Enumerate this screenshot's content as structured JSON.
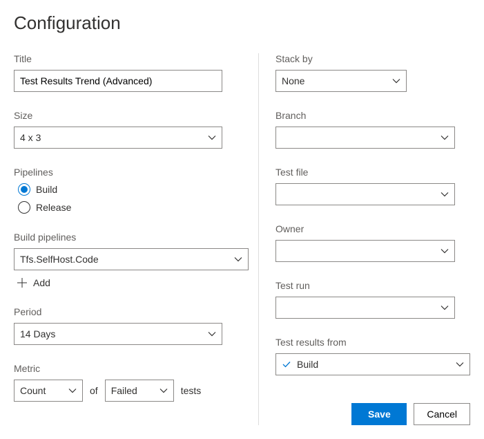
{
  "heading": "Configuration",
  "left": {
    "title_label": "Title",
    "title_value": "Test Results Trend (Advanced)",
    "size_label": "Size",
    "size_value": "4 x 3",
    "pipelines_label": "Pipelines",
    "pipelines_options": {
      "build": "Build",
      "release": "Release"
    },
    "build_pipelines_label": "Build pipelines",
    "build_pipelines_value": "Tfs.SelfHost.Code",
    "add_label": "Add",
    "period_label": "Period",
    "period_value": "14 Days",
    "metric_label": "Metric",
    "metric_count": "Count",
    "metric_of": "of",
    "metric_status": "Failed",
    "metric_tests": "tests"
  },
  "right": {
    "stack_by_label": "Stack by",
    "stack_by_value": "None",
    "branch_label": "Branch",
    "branch_value": "",
    "test_file_label": "Test file",
    "test_file_value": "",
    "owner_label": "Owner",
    "owner_value": "",
    "test_run_label": "Test run",
    "test_run_value": "",
    "results_from_label": "Test results from",
    "results_from_value": "Build"
  },
  "buttons": {
    "save": "Save",
    "cancel": "Cancel"
  }
}
